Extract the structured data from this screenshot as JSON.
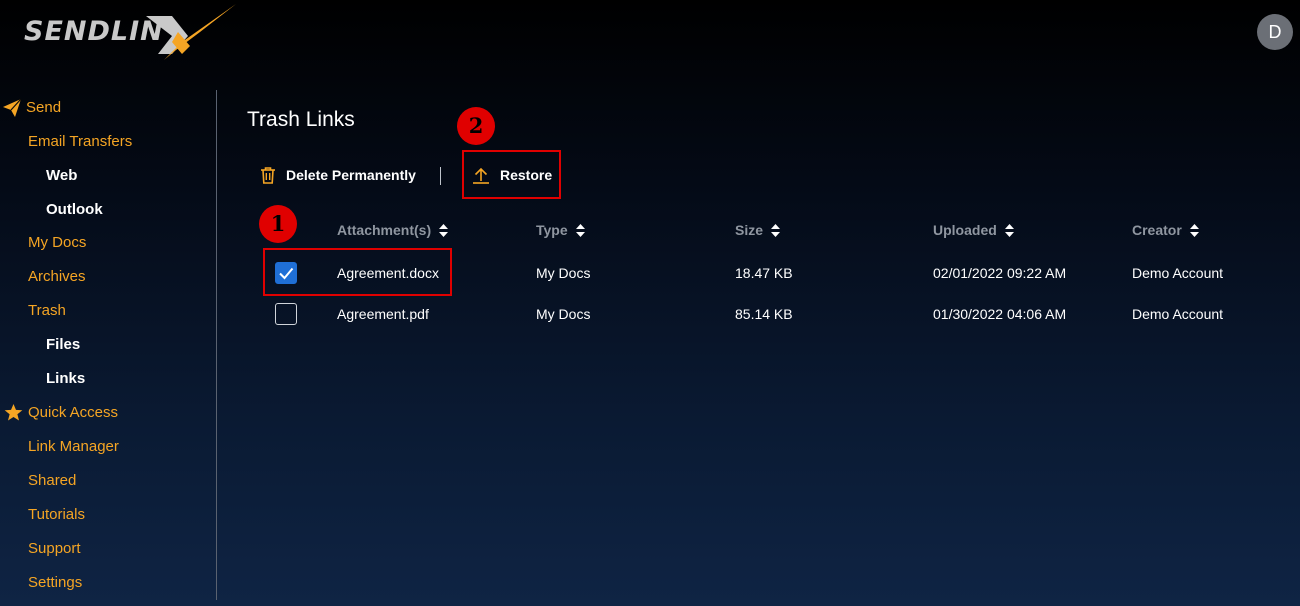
{
  "app": {
    "logo_text": "SENDLIN",
    "avatar_initial": "D"
  },
  "sidebar": {
    "items": [
      {
        "label": "Send",
        "icon": "paper-plane-icon"
      },
      {
        "label": "Email Transfers"
      },
      {
        "label": "Web"
      },
      {
        "label": "Outlook"
      },
      {
        "label": "My Docs"
      },
      {
        "label": "Archives"
      },
      {
        "label": "Trash"
      },
      {
        "label": "Files"
      },
      {
        "label": "Links"
      },
      {
        "label": "Quick Access",
        "icon": "star-icon"
      },
      {
        "label": "Link Manager"
      },
      {
        "label": "Shared"
      },
      {
        "label": "Tutorials"
      },
      {
        "label": "Support"
      },
      {
        "label": "Settings"
      }
    ]
  },
  "main": {
    "title": "Trash Links",
    "toolbar": {
      "delete_label": "Delete Permanently",
      "restore_label": "Restore"
    },
    "annotations": {
      "step1": "1",
      "step2": "2"
    },
    "table": {
      "headers": [
        "Attachment(s)",
        "Type",
        "Size",
        "Uploaded",
        "Creator"
      ],
      "rows": [
        {
          "checked": true,
          "cells": [
            "Agreement.docx",
            "My Docs",
            "18.47 KB",
            "02/01/2022 09:22 AM",
            "Demo Account"
          ]
        },
        {
          "checked": false,
          "cells": [
            "Agreement.pdf",
            "My Docs",
            "85.14 KB",
            "01/30/2022 04:06 AM",
            "Demo Account"
          ]
        }
      ]
    }
  },
  "colors": {
    "accent": "#f5a524",
    "highlight": "#e00000",
    "checkbox": "#1f6fd6"
  }
}
